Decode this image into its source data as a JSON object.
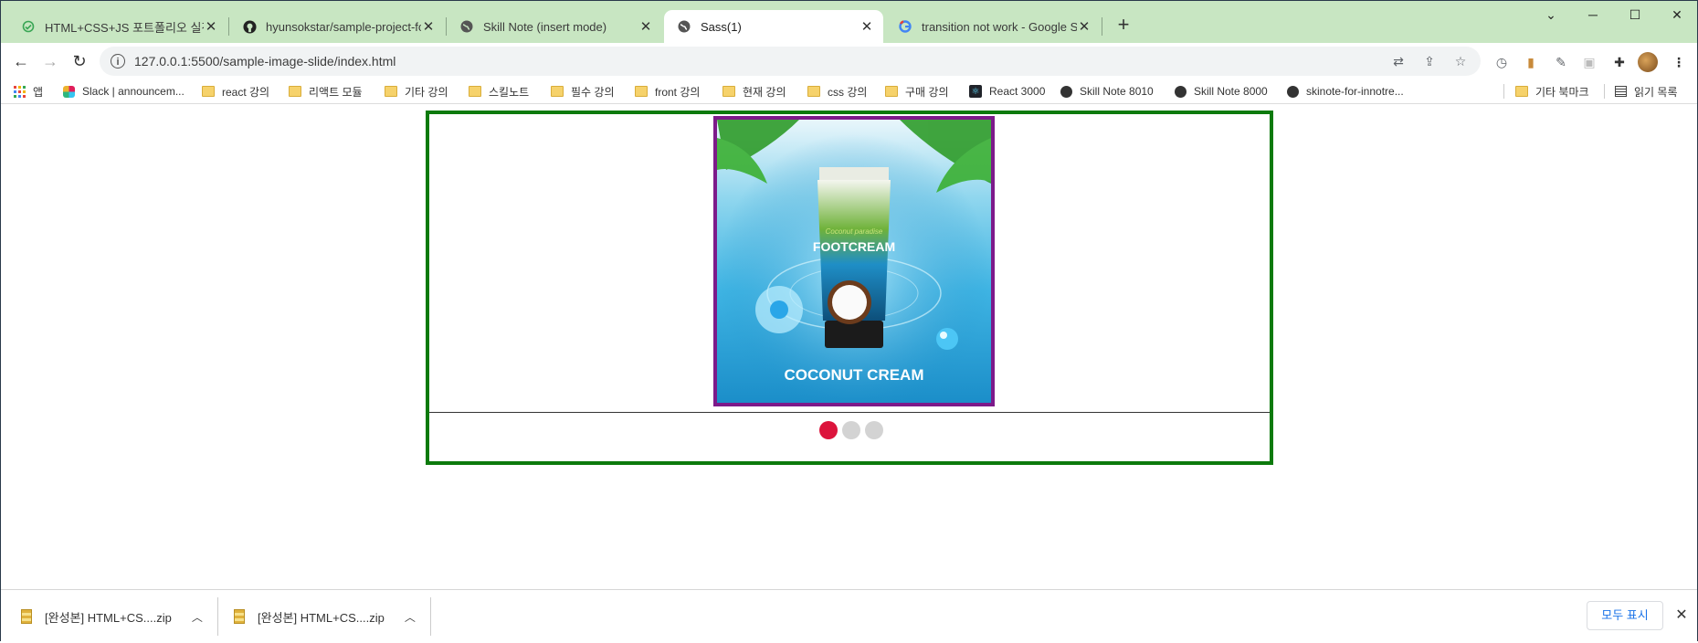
{
  "tabs": [
    {
      "title": "HTML+CSS+JS 포트폴리오 실전",
      "favicon": "green-loading-icon",
      "active": false
    },
    {
      "title": "hyunsokstar/sample-project-for",
      "favicon": "github-icon",
      "active": false
    },
    {
      "title": "Skill Note (insert mode)",
      "favicon": "globe-icon",
      "active": false
    },
    {
      "title": "Sass(1)",
      "favicon": "globe-icon",
      "active": true
    },
    {
      "title": "transition not work - Google Se",
      "favicon": "google-icon",
      "active": false
    }
  ],
  "address_bar": {
    "url": "127.0.0.1:5500/sample-image-slide/index.html"
  },
  "bookmarks": {
    "apps_label": "앱",
    "items": [
      {
        "label": "Slack | announcem...",
        "icon": "slack-icon"
      },
      {
        "label": "react 강의",
        "icon": "folder-icon"
      },
      {
        "label": "리액트 모듈",
        "icon": "folder-icon"
      },
      {
        "label": "기타 강의",
        "icon": "folder-icon"
      },
      {
        "label": "스킬노트",
        "icon": "folder-icon"
      },
      {
        "label": "필수 강의",
        "icon": "folder-icon"
      },
      {
        "label": "front 강의",
        "icon": "folder-icon"
      },
      {
        "label": "현재 강의",
        "icon": "folder-icon"
      },
      {
        "label": "css 강의",
        "icon": "folder-icon"
      },
      {
        "label": "구매 강의",
        "icon": "folder-icon"
      },
      {
        "label": "React 3000",
        "icon": "react-icon"
      },
      {
        "label": "Skill Note 8010",
        "icon": "globe-icon"
      },
      {
        "label": "Skill Note 8000",
        "icon": "globe-icon"
      },
      {
        "label": "skinote-for-innotre...",
        "icon": "globe-icon"
      }
    ],
    "other_bookmarks": "기타 북마크",
    "reading_list": "읽기 목록"
  },
  "slider": {
    "image": {
      "product_text": "COCONUT CREAM",
      "tube_text": "FOOTCREAM",
      "tube_script": "Coconut paradise"
    },
    "dots": [
      {
        "active": true
      },
      {
        "active": false
      },
      {
        "active": false
      }
    ],
    "colors": {
      "frame": "#0c7a0c",
      "image_border": "#7d1a8a",
      "dot_active": "#dc143c",
      "dot_inactive": "#d3d3d3"
    }
  },
  "downloads": {
    "items": [
      {
        "filename": "[완성본] HTML+CS....zip"
      },
      {
        "filename": "[완성본] HTML+CS....zip"
      }
    ],
    "show_all_label": "모두 표시"
  }
}
